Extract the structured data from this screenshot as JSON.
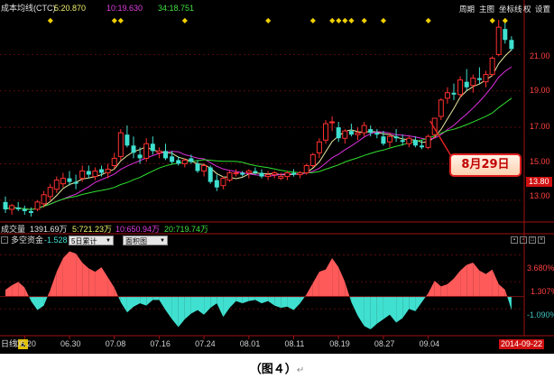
{
  "header": {
    "indicator_name": "成本均线(CTC)",
    "ma1": "5:20.870",
    "ma2": "10:19.630",
    "ma3": "34:18.751"
  },
  "menu": {
    "period": "周期",
    "main_chart": "主图",
    "coordinate": "坐标线",
    "right": "权",
    "settings": "设置"
  },
  "price_axis": {
    "labels": [
      "21.00",
      "19.00",
      "17.00",
      "15.00",
      "13.00"
    ],
    "current_low": "13.80"
  },
  "callout": "8月29日",
  "volume": {
    "label": "成交量",
    "total": "1391.69万",
    "v5": "5:721.23万",
    "v10": "10:650.94万",
    "v20": "20:719.74万"
  },
  "indicator": {
    "name": "多空资金",
    "value": "-1.528",
    "period_select": "5日累计",
    "chart_select": "面积图",
    "axis": [
      "3.680%",
      "1.307%",
      "-1.090%"
    ]
  },
  "date_axis": {
    "title": "日线",
    "dates": [
      "06.20",
      "06.30",
      "07.08",
      "07.16",
      "07.24",
      "08.01",
      "08.11",
      "08.19",
      "08.27",
      "09.04"
    ],
    "current": "2014-09-22"
  },
  "caption": "（图４）",
  "caption_mark": "↵",
  "chart_data": {
    "type": "candlestick",
    "ohlc": [
      [
        12.9,
        13.2,
        12.3,
        12.5
      ],
      [
        12.5,
        12.8,
        12.2,
        12.7
      ],
      [
        12.6,
        12.9,
        12.4,
        12.5
      ],
      [
        12.5,
        12.7,
        12.2,
        12.4
      ],
      [
        12.4,
        12.6,
        12.1,
        12.3
      ],
      [
        12.5,
        13.0,
        12.4,
        12.9
      ],
      [
        12.8,
        13.5,
        12.6,
        13.3
      ],
      [
        13.2,
        13.9,
        13.0,
        13.7
      ],
      [
        13.6,
        14.3,
        13.4,
        14.1
      ],
      [
        13.9,
        14.5,
        13.7,
        14.2
      ],
      [
        14.2,
        14.6,
        13.8,
        14.0
      ],
      [
        14.0,
        14.4,
        13.6,
        13.9
      ],
      [
        14.2,
        14.9,
        14.0,
        14.6
      ],
      [
        14.6,
        14.9,
        14.2,
        14.4
      ],
      [
        14.3,
        14.8,
        14.1,
        14.6
      ],
      [
        14.7,
        14.9,
        14.3,
        14.5
      ],
      [
        14.5,
        15.0,
        14.2,
        14.7
      ],
      [
        14.9,
        15.6,
        14.7,
        15.3
      ],
      [
        15.4,
        16.9,
        15.2,
        16.7
      ],
      [
        16.6,
        17.1,
        15.9,
        16.0
      ],
      [
        16.0,
        16.5,
        15.3,
        15.6
      ],
      [
        15.5,
        15.9,
        15.0,
        15.3
      ],
      [
        15.3,
        16.4,
        15.1,
        16.1
      ],
      [
        16.1,
        16.5,
        15.5,
        15.7
      ],
      [
        15.6,
        15.9,
        15.3,
        15.7
      ],
      [
        15.7,
        16.1,
        15.2,
        15.3
      ],
      [
        15.4,
        15.7,
        15.0,
        15.1
      ],
      [
        15.2,
        15.4,
        14.9,
        15.0
      ],
      [
        15.0,
        15.3,
        14.8,
        15.2
      ],
      [
        15.3,
        15.5,
        15.0,
        15.1
      ],
      [
        15.0,
        15.2,
        14.5,
        14.6
      ],
      [
        14.6,
        15.0,
        14.3,
        14.9
      ],
      [
        14.8,
        14.9,
        13.9,
        14.0
      ],
      [
        14.1,
        14.4,
        13.5,
        13.7
      ],
      [
        13.8,
        14.3,
        13.6,
        14.2
      ],
      [
        14.1,
        14.6,
        14.0,
        14.5
      ],
      [
        14.5,
        14.7,
        14.3,
        14.5
      ],
      [
        14.5,
        14.6,
        14.3,
        14.4
      ],
      [
        14.5,
        14.7,
        14.2,
        14.6
      ],
      [
        14.6,
        14.8,
        14.4,
        14.5
      ],
      [
        14.5,
        14.7,
        14.2,
        14.3
      ],
      [
        14.3,
        14.6,
        14.1,
        14.4
      ],
      [
        14.4,
        14.6,
        14.2,
        14.5
      ],
      [
        14.2,
        14.5,
        14.1,
        14.3
      ],
      [
        14.3,
        14.6,
        14.1,
        14.5
      ],
      [
        14.5,
        14.7,
        14.3,
        14.4
      ],
      [
        14.4,
        14.6,
        14.2,
        14.5
      ],
      [
        14.5,
        15.0,
        14.4,
        14.9
      ],
      [
        14.9,
        15.6,
        14.8,
        15.5
      ],
      [
        15.6,
        16.4,
        15.3,
        16.2
      ],
      [
        16.3,
        17.4,
        16.1,
        17.2
      ],
      [
        17.3,
        17.6,
        16.8,
        17.3
      ],
      [
        17.0,
        17.3,
        16.2,
        16.4
      ],
      [
        16.4,
        16.9,
        16.1,
        16.8
      ],
      [
        16.8,
        17.2,
        16.5,
        16.6
      ],
      [
        16.6,
        17.0,
        16.3,
        16.7
      ],
      [
        16.7,
        17.3,
        16.5,
        17.1
      ],
      [
        16.9,
        17.1,
        16.5,
        16.7
      ],
      [
        16.7,
        16.9,
        16.4,
        16.6
      ],
      [
        16.5,
        16.8,
        16.0,
        16.1
      ],
      [
        16.2,
        16.7,
        15.9,
        16.5
      ],
      [
        16.5,
        16.9,
        16.2,
        16.4
      ],
      [
        16.3,
        16.6,
        16.0,
        16.2
      ],
      [
        16.1,
        16.5,
        15.9,
        16.4
      ],
      [
        16.3,
        16.5,
        15.9,
        16.0
      ],
      [
        16.0,
        16.3,
        15.8,
        15.9
      ],
      [
        15.9,
        16.6,
        15.8,
        16.5
      ],
      [
        16.6,
        17.5,
        16.4,
        17.5
      ],
      [
        17.6,
        18.6,
        17.4,
        18.5
      ],
      [
        18.6,
        19.2,
        18.3,
        18.9
      ],
      [
        18.9,
        19.4,
        18.5,
        18.8
      ],
      [
        18.8,
        19.8,
        18.6,
        19.6
      ],
      [
        19.5,
        20.2,
        19.0,
        19.2
      ],
      [
        19.3,
        19.9,
        18.9,
        19.7
      ],
      [
        19.7,
        20.3,
        19.4,
        19.6
      ],
      [
        19.5,
        20.1,
        19.2,
        19.9
      ],
      [
        19.9,
        20.9,
        19.8,
        20.8
      ],
      [
        21.0,
        22.9,
        20.9,
        22.5
      ],
      [
        22.4,
        22.9,
        21.6,
        21.8
      ],
      [
        21.8,
        22.0,
        21.2,
        21.3
      ]
    ],
    "ylim": [
      12.0,
      23.2
    ],
    "axis_ticks": [
      13,
      15,
      17,
      19,
      21
    ],
    "moneyflow": [
      0.6,
      1.0,
      1.3,
      0.8,
      -0.4,
      -1.2,
      -0.8,
      0.6,
      2.2,
      3.4,
      4.0,
      3.8,
      3.0,
      2.5,
      2.2,
      2.6,
      1.7,
      0.8,
      -0.5,
      -1.4,
      -0.9,
      -0.6,
      -0.8,
      -0.3,
      -0.3,
      -1.2,
      -2.0,
      -2.7,
      -2.0,
      -1.5,
      -1.2,
      -1.6,
      -1.0,
      -0.6,
      -1.8,
      -1.0,
      -0.4,
      -0.6,
      -0.4,
      -0.3,
      -0.6,
      -0.4,
      -0.8,
      -1.0,
      -0.9,
      -1.2,
      -0.6,
      0.2,
      1.2,
      2.2,
      2.4,
      3.4,
      2.6,
      1.3,
      -0.5,
      -1.7,
      -2.6,
      -2.9,
      -2.4,
      -2.0,
      -1.6,
      -2.3,
      -1.9,
      -1.1,
      -1.3,
      -0.5,
      0.3,
      1.4,
      0.9,
      1.1,
      1.6,
      2.3,
      2.8,
      3.0,
      2.3,
      2.0,
      2.4,
      1.1,
      0.6,
      -1.2
    ],
    "moneyflow_ylim": [
      -3.3,
      4.6
    ],
    "moneyflow_ticks": [
      3.68,
      1.307,
      -1.09
    ],
    "moneyflow_pos_color": "#ff5a5a",
    "moneyflow_neg_color": "#40e0d0",
    "up_color": "#ff3030",
    "down_color": "#3fe0d0",
    "ma_colors": [
      "#e8e8a0",
      "#e030e0",
      "#30e030"
    ],
    "xtick_index": [
      3,
      10,
      17,
      24,
      31,
      38,
      45,
      52,
      59,
      66
    ]
  }
}
